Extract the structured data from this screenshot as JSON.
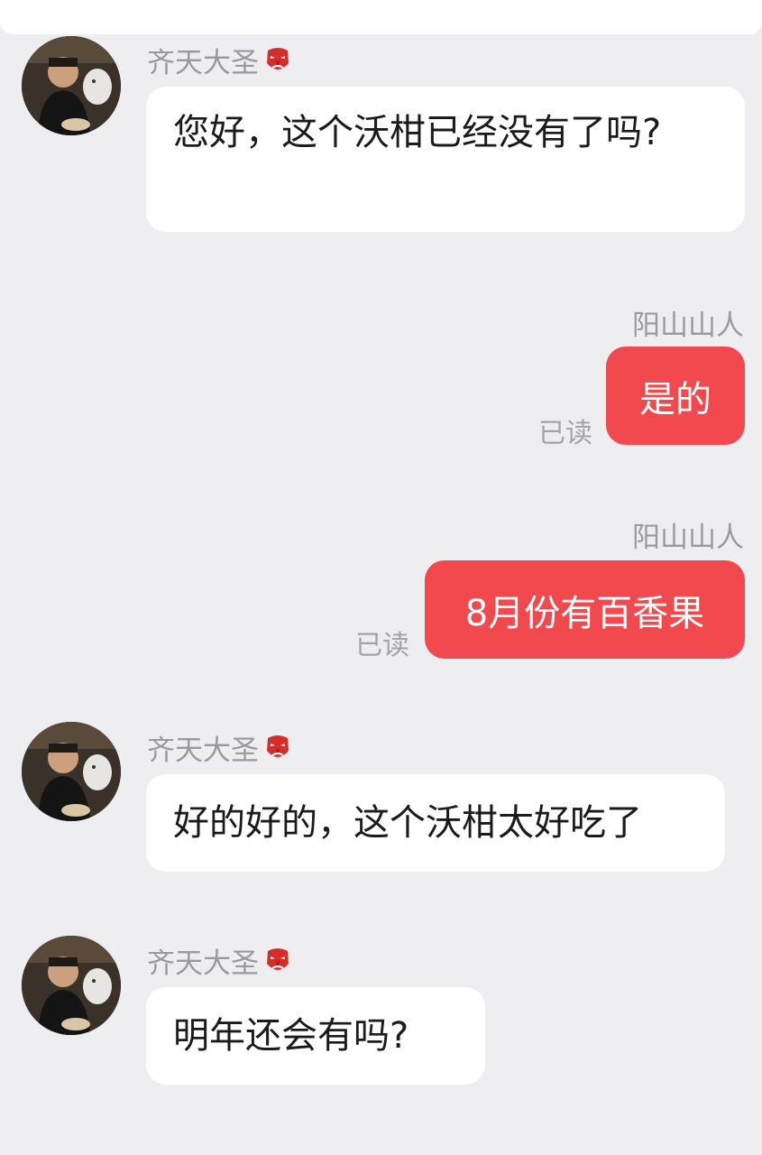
{
  "messages": [
    {
      "sender": "齐天大圣",
      "badge": "red-mask-emoji",
      "text": "您好，这个沃柑已经没有了吗?"
    },
    {
      "sender": "阳山山人",
      "text": "是的",
      "status": "已读"
    },
    {
      "sender": "阳山山人",
      "text": "8月份有百香果",
      "status": "已读"
    },
    {
      "sender": "齐天大圣",
      "badge": "red-mask-emoji",
      "text": "好的好的，这个沃柑太好吃了"
    },
    {
      "sender": "齐天大圣",
      "badge": "red-mask-emoji",
      "text": "明年还会有吗?"
    }
  ],
  "colors": {
    "background": "#eeeef1",
    "outgoing_bubble": "#f1494d",
    "incoming_bubble": "#ffffff",
    "meta_text": "#9a9a9e"
  }
}
